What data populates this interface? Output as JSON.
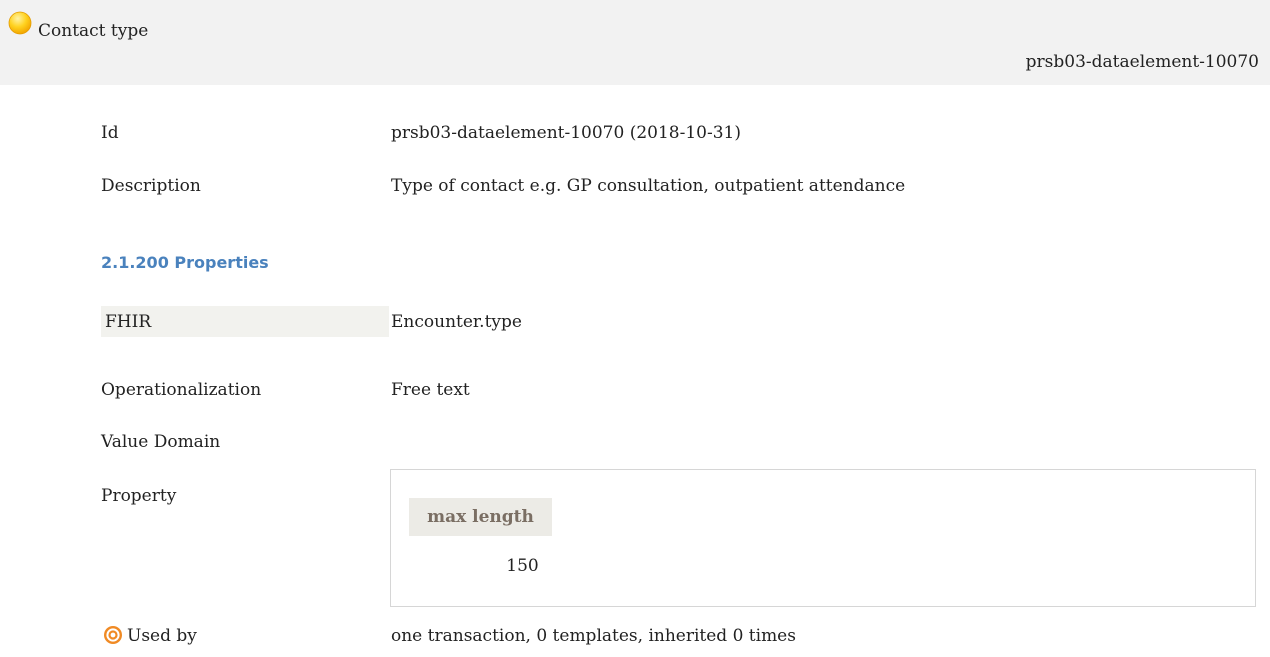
{
  "header": {
    "status_icon": "yellow-circle-status-icon",
    "title": "Contact type",
    "element_id": "prsb03-dataelement-10070"
  },
  "details": {
    "id_label": "Id",
    "id_value": "prsb03-dataelement-10070 (2018-10-31)",
    "description_label": "Description",
    "description_value": "Type of contact e.g. GP consultation, outpatient attendance"
  },
  "properties": {
    "heading": "2.1.200 Properties",
    "fhir_label": "FHIR",
    "fhir_value": "Encounter.type",
    "operationalization_label": "Operationalization",
    "operationalization_value": "Free text",
    "value_domain_label": "Value Domain",
    "property_label": "Property",
    "max_length_header": "max length",
    "max_length_value": "150"
  },
  "used_by": {
    "icon": "target-icon",
    "label": "Used by",
    "value": "one transaction, 0 templates, inherited 0 times"
  },
  "colors": {
    "header_bg": "#f2f2f2",
    "heading_blue": "#4a82bd",
    "status_yellow": "#f7b500",
    "target_orange": "#f08a24",
    "max_length_header_bg": "#ecebe6",
    "max_length_header_text": "#7a6e63"
  }
}
